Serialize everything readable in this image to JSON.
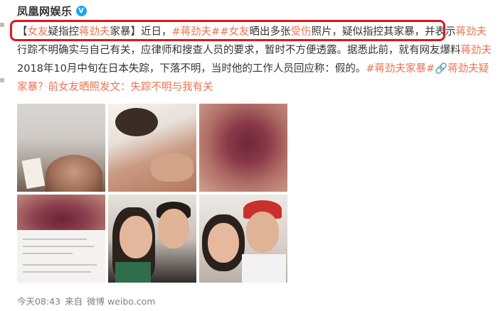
{
  "post": {
    "author": "凤凰网娱乐",
    "verified_badge": "V",
    "segments": [
      {
        "t": "【",
        "c": "normal"
      },
      {
        "t": "女友",
        "c": "hl"
      },
      {
        "t": "疑指控",
        "c": "normal"
      },
      {
        "t": "蒋劲夫",
        "c": "hl"
      },
      {
        "t": "家暴】近日，",
        "c": "normal"
      },
      {
        "t": "#蒋劲夫#",
        "c": "tag"
      },
      {
        "t": "#女友",
        "c": "tag"
      },
      {
        "t": "晒出多张",
        "c": "normal"
      },
      {
        "t": "受伤",
        "c": "hl"
      },
      {
        "t": "照片，疑似指控其家暴，并表示",
        "c": "normal"
      },
      {
        "t": "蒋劲夫",
        "c": "hl"
      },
      {
        "t": "行踪不明确实与自己有关，应律师和搜查人员的要求，暂时不方便透露。据悉此前，就有网友爆料",
        "c": "normal"
      },
      {
        "t": "蒋劲夫",
        "c": "hl"
      },
      {
        "t": "2018年10月中旬在日本失踪，下落不明，当时他的工作人员回应称：假的。",
        "c": "normal"
      },
      {
        "t": "#蒋劲夫家暴#",
        "c": "tag"
      },
      {
        "t": "🔗",
        "c": "tag"
      },
      {
        "t": "蒋劲夫",
        "c": "hl"
      },
      {
        "t": "疑家暴？前",
        "c": "link"
      },
      {
        "t": "女友",
        "c": "hl"
      },
      {
        "t": "晒照发文：失踪不明与我有关",
        "c": "link"
      }
    ],
    "footer": {
      "time": "今天08:43",
      "source_prefix": "来自",
      "source": "微博 weibo.com"
    }
  },
  "colors": {
    "accent": "#eb7350",
    "highlight_box": "#e0161a",
    "text": "#333333",
    "meta": "#808080"
  },
  "photos": [
    {
      "name": "photo-injured-face-lying"
    },
    {
      "name": "photo-woman-shoulder-bruise"
    },
    {
      "name": "photo-bruise-closeup"
    },
    {
      "name": "photo-bruise-with-caption-screenshot"
    },
    {
      "name": "photo-couple-selfie-1"
    },
    {
      "name": "photo-couple-selfie-2"
    }
  ]
}
